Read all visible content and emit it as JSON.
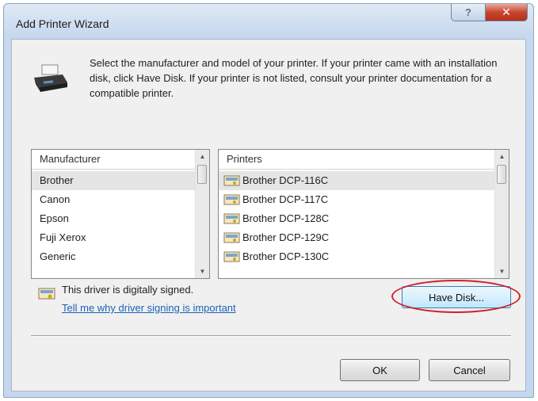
{
  "window": {
    "title": "Add Printer Wizard",
    "help_label": "?",
    "close_label": "✕"
  },
  "header": {
    "instructions": "Select the manufacturer and model of your printer. If your printer came with an installation disk, click Have Disk. If your printer is not listed, consult your printer documentation for a compatible printer."
  },
  "manufacturer_list": {
    "header": "Manufacturer",
    "items": [
      "Brother",
      "Canon",
      "Epson",
      "Fuji Xerox",
      "Generic"
    ],
    "selected": "Brother"
  },
  "printer_list": {
    "header": "Printers",
    "items": [
      "Brother DCP-116C",
      "Brother DCP-117C",
      "Brother DCP-128C",
      "Brother DCP-129C",
      "Brother DCP-130C"
    ],
    "selected": "Brother DCP-116C"
  },
  "signing": {
    "status_text": "This driver is digitally signed.",
    "link_text": "Tell me why driver signing is important"
  },
  "buttons": {
    "have_disk": "Have Disk...",
    "ok": "OK",
    "cancel": "Cancel"
  },
  "colors": {
    "accent_link": "#1a63b8",
    "highlight_ring": "#d0202a"
  }
}
